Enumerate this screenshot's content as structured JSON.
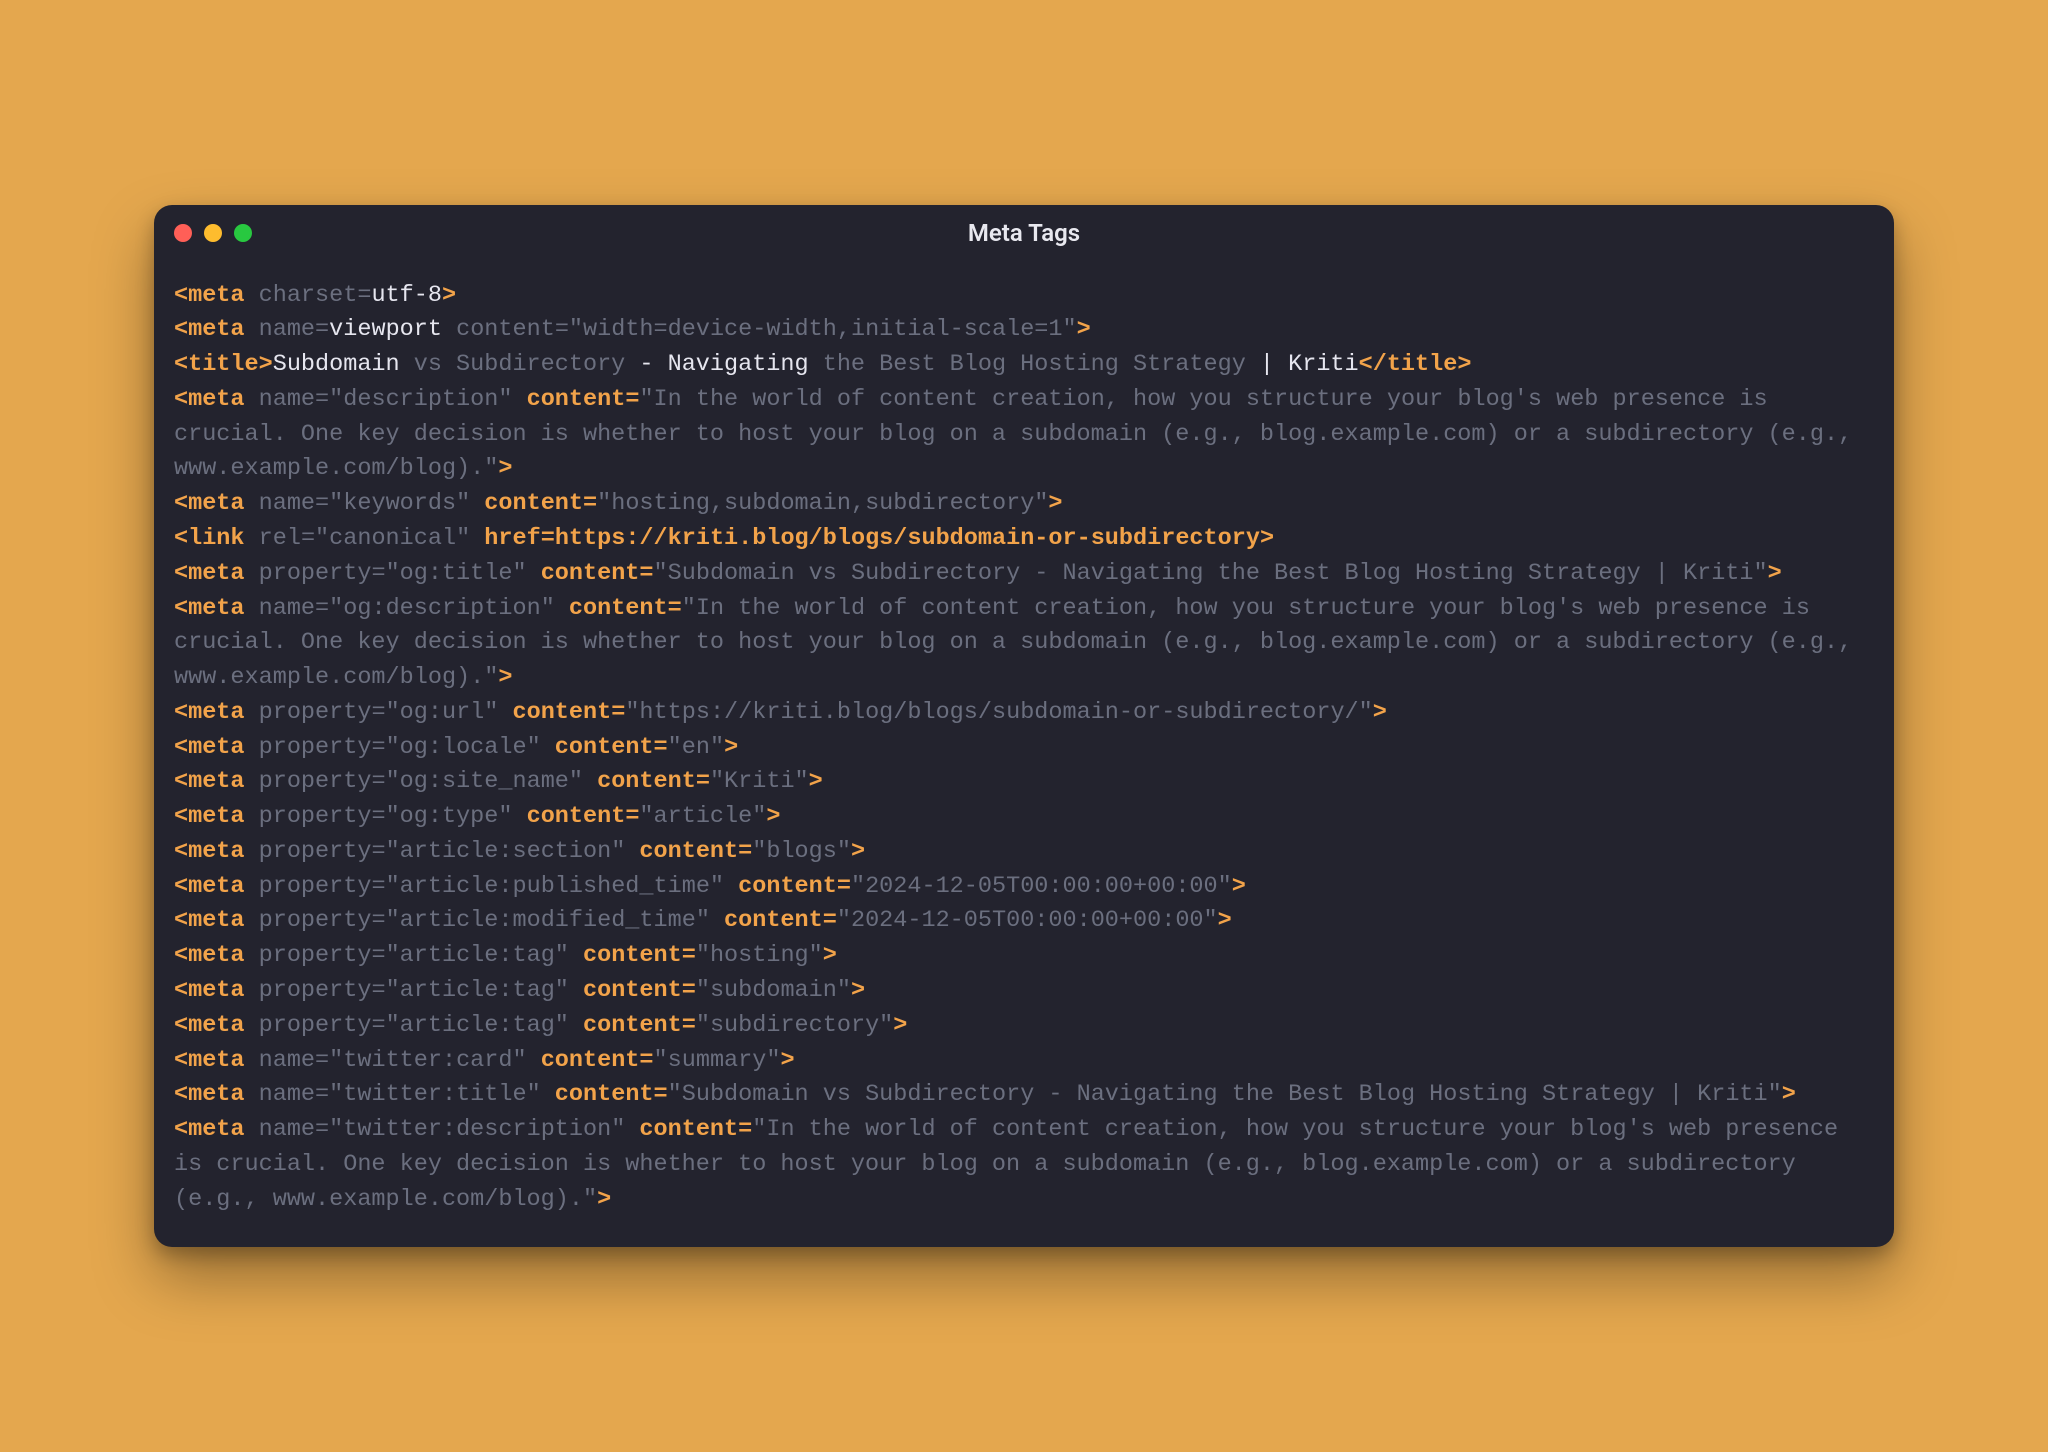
{
  "window": {
    "title": "Meta Tags"
  },
  "lines": [
    {
      "segs": [
        {
          "t": "<meta ",
          "c": "t-tag"
        },
        {
          "t": "charset",
          "c": "t-attr"
        },
        {
          "t": "=",
          "c": "t-attr"
        },
        {
          "t": "utf-8",
          "c": "t-white"
        },
        {
          "t": ">",
          "c": "t-tag"
        }
      ]
    },
    {
      "segs": [
        {
          "t": "<meta ",
          "c": "t-tag"
        },
        {
          "t": "name",
          "c": "t-attr"
        },
        {
          "t": "=",
          "c": "t-attr"
        },
        {
          "t": "viewport",
          "c": "t-white"
        },
        {
          "t": " content",
          "c": "t-attr"
        },
        {
          "t": "=",
          "c": "t-attr"
        },
        {
          "t": "\"width=device-width,initial-scale=1\"",
          "c": "t-val"
        },
        {
          "t": ">",
          "c": "t-tag"
        }
      ]
    },
    {
      "segs": [
        {
          "t": "<title>",
          "c": "t-tag"
        },
        {
          "t": "Subdomain",
          "c": "t-white"
        },
        {
          "t": " vs Subdirectory",
          "c": "t-dim"
        },
        {
          "t": " - ",
          "c": "t-white"
        },
        {
          "t": "Navigating",
          "c": "t-white"
        },
        {
          "t": " the Best Blog Hosting Strategy",
          "c": "t-dim"
        },
        {
          "t": " | ",
          "c": "t-white"
        },
        {
          "t": "Kriti",
          "c": "t-white"
        },
        {
          "t": "</title>",
          "c": "t-tag"
        }
      ]
    },
    {
      "segs": [
        {
          "t": "<meta ",
          "c": "t-tag"
        },
        {
          "t": "name",
          "c": "t-attr"
        },
        {
          "t": "=",
          "c": "t-attr"
        },
        {
          "t": "\"description\"",
          "c": "t-val"
        },
        {
          "t": " content",
          "c": "t-attrO"
        },
        {
          "t": "=",
          "c": "t-attrO"
        },
        {
          "t": "\"In the world of content creation, how you structure your blog's web presence is crucial. One key decision is whether to host your blog on a subdomain (e.g., blog.example.com) or a subdirectory (e.g., www.example.com/blog).\"",
          "c": "t-val"
        },
        {
          "t": ">",
          "c": "t-tag"
        }
      ]
    },
    {
      "segs": [
        {
          "t": "<meta ",
          "c": "t-tag"
        },
        {
          "t": "name",
          "c": "t-attr"
        },
        {
          "t": "=",
          "c": "t-attr"
        },
        {
          "t": "\"keywords\"",
          "c": "t-val"
        },
        {
          "t": " content",
          "c": "t-attrO"
        },
        {
          "t": "=",
          "c": "t-attrO"
        },
        {
          "t": "\"hosting,subdomain,subdirectory\"",
          "c": "t-val"
        },
        {
          "t": ">",
          "c": "t-tag"
        }
      ]
    },
    {
      "segs": [
        {
          "t": "<link ",
          "c": "t-tag"
        },
        {
          "t": "rel",
          "c": "t-attr"
        },
        {
          "t": "=",
          "c": "t-attr"
        },
        {
          "t": "\"canonical\"",
          "c": "t-val"
        },
        {
          "t": " href",
          "c": "t-attrO"
        },
        {
          "t": "=",
          "c": "t-attrO"
        },
        {
          "t": "https://kriti.blog/blogs/subdomain-or-subdirectory",
          "c": "t-gold"
        },
        {
          "t": ">",
          "c": "t-tag"
        }
      ]
    },
    {
      "segs": [
        {
          "t": "<meta ",
          "c": "t-tag"
        },
        {
          "t": "property",
          "c": "t-attr"
        },
        {
          "t": "=",
          "c": "t-attr"
        },
        {
          "t": "\"og:title\"",
          "c": "t-val"
        },
        {
          "t": " content",
          "c": "t-attrO"
        },
        {
          "t": "=",
          "c": "t-attrO"
        },
        {
          "t": "\"Subdomain vs Subdirectory - Navigating the Best Blog Hosting Strategy | Kriti\"",
          "c": "t-val"
        },
        {
          "t": ">",
          "c": "t-tag"
        }
      ]
    },
    {
      "segs": [
        {
          "t": "<meta ",
          "c": "t-tag"
        },
        {
          "t": "name",
          "c": "t-attr"
        },
        {
          "t": "=",
          "c": "t-attr"
        },
        {
          "t": "\"og:description\"",
          "c": "t-val"
        },
        {
          "t": " content",
          "c": "t-attrO"
        },
        {
          "t": "=",
          "c": "t-attrO"
        },
        {
          "t": "\"In the world of content creation, how you structure your blog's web presence is crucial. One key decision is whether to host your blog on a subdomain (e.g., blog.example.com) or a subdirectory (e.g., www.example.com/blog).\"",
          "c": "t-val"
        },
        {
          "t": ">",
          "c": "t-tag"
        }
      ]
    },
    {
      "segs": [
        {
          "t": "<meta ",
          "c": "t-tag"
        },
        {
          "t": "property",
          "c": "t-attr"
        },
        {
          "t": "=",
          "c": "t-attr"
        },
        {
          "t": "\"og:url\"",
          "c": "t-val"
        },
        {
          "t": " content",
          "c": "t-attrO"
        },
        {
          "t": "=",
          "c": "t-attrO"
        },
        {
          "t": "\"https://kriti.blog/blogs/subdomain-or-subdirectory/\"",
          "c": "t-val"
        },
        {
          "t": ">",
          "c": "t-tag"
        }
      ]
    },
    {
      "segs": [
        {
          "t": "<meta ",
          "c": "t-tag"
        },
        {
          "t": "property",
          "c": "t-attr"
        },
        {
          "t": "=",
          "c": "t-attr"
        },
        {
          "t": "\"og:locale\"",
          "c": "t-val"
        },
        {
          "t": " content",
          "c": "t-attrO"
        },
        {
          "t": "=",
          "c": "t-attrO"
        },
        {
          "t": "\"en\"",
          "c": "t-val"
        },
        {
          "t": ">",
          "c": "t-tag"
        }
      ]
    },
    {
      "segs": [
        {
          "t": "<meta ",
          "c": "t-tag"
        },
        {
          "t": "property",
          "c": "t-attr"
        },
        {
          "t": "=",
          "c": "t-attr"
        },
        {
          "t": "\"og:site_name\"",
          "c": "t-val"
        },
        {
          "t": " content",
          "c": "t-attrO"
        },
        {
          "t": "=",
          "c": "t-attrO"
        },
        {
          "t": "\"Kriti\"",
          "c": "t-val"
        },
        {
          "t": ">",
          "c": "t-tag"
        }
      ]
    },
    {
      "segs": [
        {
          "t": "<meta ",
          "c": "t-tag"
        },
        {
          "t": "property",
          "c": "t-attr"
        },
        {
          "t": "=",
          "c": "t-attr"
        },
        {
          "t": "\"og:type\"",
          "c": "t-val"
        },
        {
          "t": " content",
          "c": "t-attrO"
        },
        {
          "t": "=",
          "c": "t-attrO"
        },
        {
          "t": "\"article\"",
          "c": "t-val"
        },
        {
          "t": ">",
          "c": "t-tag"
        }
      ]
    },
    {
      "segs": [
        {
          "t": "<meta ",
          "c": "t-tag"
        },
        {
          "t": "property",
          "c": "t-attr"
        },
        {
          "t": "=",
          "c": "t-attr"
        },
        {
          "t": "\"article:section\"",
          "c": "t-val"
        },
        {
          "t": " content",
          "c": "t-attrO"
        },
        {
          "t": "=",
          "c": "t-attrO"
        },
        {
          "t": "\"blogs\"",
          "c": "t-val"
        },
        {
          "t": ">",
          "c": "t-tag"
        }
      ]
    },
    {
      "segs": [
        {
          "t": "<meta ",
          "c": "t-tag"
        },
        {
          "t": "property",
          "c": "t-attr"
        },
        {
          "t": "=",
          "c": "t-attr"
        },
        {
          "t": "\"article:published_time\"",
          "c": "t-val"
        },
        {
          "t": " content",
          "c": "t-attrO"
        },
        {
          "t": "=",
          "c": "t-attrO"
        },
        {
          "t": "\"2024-12-05T00:00:00+00:00\"",
          "c": "t-val"
        },
        {
          "t": ">",
          "c": "t-tag"
        }
      ]
    },
    {
      "segs": [
        {
          "t": "<meta ",
          "c": "t-tag"
        },
        {
          "t": "property",
          "c": "t-attr"
        },
        {
          "t": "=",
          "c": "t-attr"
        },
        {
          "t": "\"article:modified_time\"",
          "c": "t-val"
        },
        {
          "t": " content",
          "c": "t-attrO"
        },
        {
          "t": "=",
          "c": "t-attrO"
        },
        {
          "t": "\"2024-12-05T00:00:00+00:00\"",
          "c": "t-val"
        },
        {
          "t": ">",
          "c": "t-tag"
        }
      ]
    },
    {
      "segs": [
        {
          "t": "<meta ",
          "c": "t-tag"
        },
        {
          "t": "property",
          "c": "t-attr"
        },
        {
          "t": "=",
          "c": "t-attr"
        },
        {
          "t": "\"article:tag\"",
          "c": "t-val"
        },
        {
          "t": " content",
          "c": "t-attrO"
        },
        {
          "t": "=",
          "c": "t-attrO"
        },
        {
          "t": "\"hosting\"",
          "c": "t-val"
        },
        {
          "t": ">",
          "c": "t-tag"
        }
      ]
    },
    {
      "segs": [
        {
          "t": "<meta ",
          "c": "t-tag"
        },
        {
          "t": "property",
          "c": "t-attr"
        },
        {
          "t": "=",
          "c": "t-attr"
        },
        {
          "t": "\"article:tag\"",
          "c": "t-val"
        },
        {
          "t": " content",
          "c": "t-attrO"
        },
        {
          "t": "=",
          "c": "t-attrO"
        },
        {
          "t": "\"subdomain\"",
          "c": "t-val"
        },
        {
          "t": ">",
          "c": "t-tag"
        }
      ]
    },
    {
      "segs": [
        {
          "t": "<meta ",
          "c": "t-tag"
        },
        {
          "t": "property",
          "c": "t-attr"
        },
        {
          "t": "=",
          "c": "t-attr"
        },
        {
          "t": "\"article:tag\"",
          "c": "t-val"
        },
        {
          "t": " content",
          "c": "t-attrO"
        },
        {
          "t": "=",
          "c": "t-attrO"
        },
        {
          "t": "\"subdirectory\"",
          "c": "t-val"
        },
        {
          "t": ">",
          "c": "t-tag"
        }
      ]
    },
    {
      "segs": [
        {
          "t": "<meta ",
          "c": "t-tag"
        },
        {
          "t": "name",
          "c": "t-attr"
        },
        {
          "t": "=",
          "c": "t-attr"
        },
        {
          "t": "\"twitter:card\"",
          "c": "t-val"
        },
        {
          "t": " content",
          "c": "t-attrO"
        },
        {
          "t": "=",
          "c": "t-attrO"
        },
        {
          "t": "\"summary\"",
          "c": "t-val"
        },
        {
          "t": ">",
          "c": "t-tag"
        }
      ]
    },
    {
      "segs": [
        {
          "t": "<meta ",
          "c": "t-tag"
        },
        {
          "t": "name",
          "c": "t-attr"
        },
        {
          "t": "=",
          "c": "t-attr"
        },
        {
          "t": "\"twitter:title\"",
          "c": "t-val"
        },
        {
          "t": " content",
          "c": "t-attrO"
        },
        {
          "t": "=",
          "c": "t-attrO"
        },
        {
          "t": "\"Subdomain vs Subdirectory - Navigating the Best Blog Hosting Strategy | Kriti\"",
          "c": "t-val"
        },
        {
          "t": ">",
          "c": "t-tag"
        }
      ]
    },
    {
      "segs": [
        {
          "t": "<meta ",
          "c": "t-tag"
        },
        {
          "t": "name",
          "c": "t-attr"
        },
        {
          "t": "=",
          "c": "t-attr"
        },
        {
          "t": "\"twitter:description\"",
          "c": "t-val"
        },
        {
          "t": " content",
          "c": "t-attrO"
        },
        {
          "t": "=",
          "c": "t-attrO"
        },
        {
          "t": "\"In the world of content creation, how you structure your blog's web presence is crucial. One key decision is whether to host your blog on a subdomain (e.g., blog.example.com) or a subdirectory (e.g., www.example.com/blog).\"",
          "c": "t-val"
        },
        {
          "t": ">",
          "c": "t-tag"
        }
      ]
    }
  ]
}
